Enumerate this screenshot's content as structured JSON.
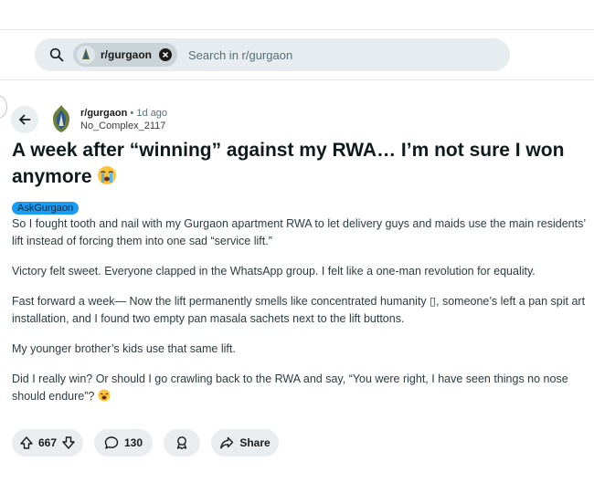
{
  "search": {
    "community_chip": "r/gurgaon",
    "placeholder": "Search in r/gurgaon"
  },
  "post": {
    "subreddit": "r/gurgaon",
    "separator": "•",
    "age": "1d ago",
    "author": "No_Complex_2117",
    "title": "A week after “winning” against my RWA… I’m not sure I won anymore",
    "flair": "AskGurgaon",
    "body": [
      "So I fought tooth and nail with my Gurgaon apartment RWA to let delivery guys and maids use the main residents’ lift instead of forcing them into one sad “service lift.”",
      "Victory felt sweet. Everyone clapped in the WhatsApp group. I felt like a one-man revolution for equality.",
      "Fast forward a week— Now the lift permanently smells like concentrated humanity ▯, someone’s left a pan spit art installation, and I found two empty pan masala sachets next to the lift buttons.",
      "My younger brother’s kids use that same lift.",
      "Did I really win? Or should I go crawling back to the RWA and say, “You were right, I have seen things no nose should endure”?"
    ]
  },
  "actions": {
    "votes": "667",
    "comments": "130",
    "share_label": "Share"
  },
  "icons": {
    "search": "search-icon",
    "close": "close-icon",
    "back": "back-arrow-icon",
    "upvote": "upvote-icon",
    "downvote": "downvote-icon",
    "comment": "comment-icon",
    "award": "award-icon",
    "share": "share-icon",
    "crying": "crying-face-emoji",
    "weary": "weary-face-emoji"
  },
  "colors": {
    "flair_bg": "#1a9cf0",
    "pill_bg": "#eaedef",
    "search_bg": "#e6ecef"
  }
}
